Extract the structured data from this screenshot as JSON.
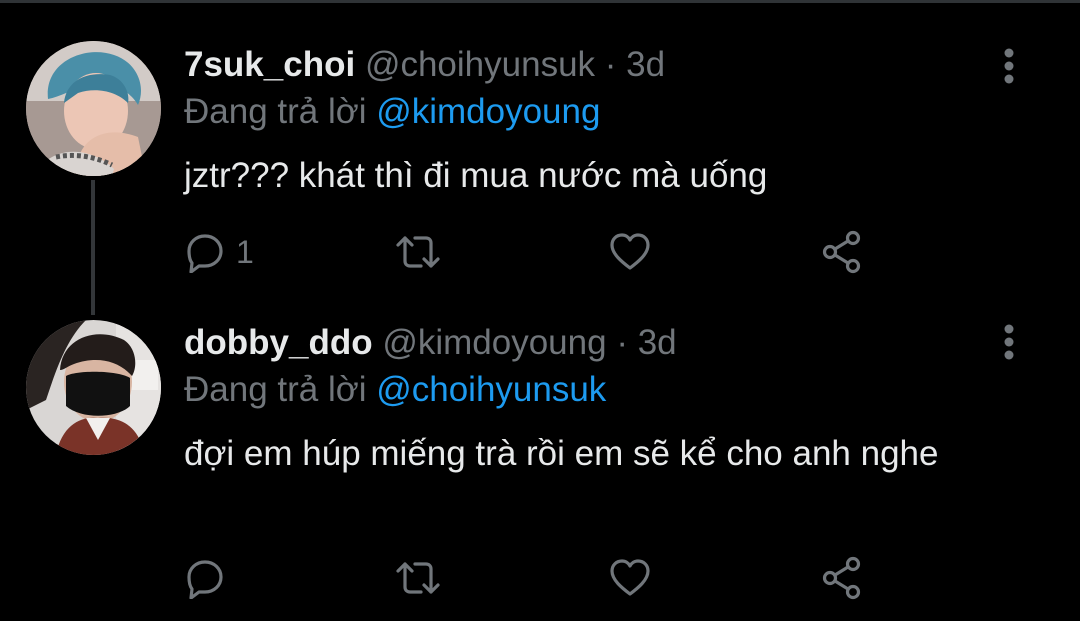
{
  "colors": {
    "background": "#000000",
    "text": "#e7e9ea",
    "secondary": "#71767b",
    "mention": "#1d9bf0",
    "thread_line": "#333639"
  },
  "tweets": [
    {
      "display_name": "7suk_choi",
      "handle": "@choihyunsuk",
      "separator": "·",
      "time": "3d",
      "reply_prefix": "Đang trả lời",
      "reply_mention": "@kimdoyoung",
      "text": "jztr??? khát thì đi mua nước mà uống",
      "reply_count": "1",
      "avatar_icon": "avatar-photo"
    },
    {
      "display_name": "dobby_ddo",
      "handle": "@kimdoyoung",
      "separator": "·",
      "time": "3d",
      "reply_prefix": "Đang trả lời",
      "reply_mention": "@choihyunsuk",
      "text": "đợi em húp miếng trà rồi em sẽ kể cho anh nghe",
      "reply_count": "",
      "avatar_icon": "avatar-photo"
    }
  ],
  "icons": {
    "reply": "reply-icon",
    "retweet": "retweet-icon",
    "like": "heart-icon",
    "share": "share-icon",
    "more": "more-vertical-icon"
  }
}
